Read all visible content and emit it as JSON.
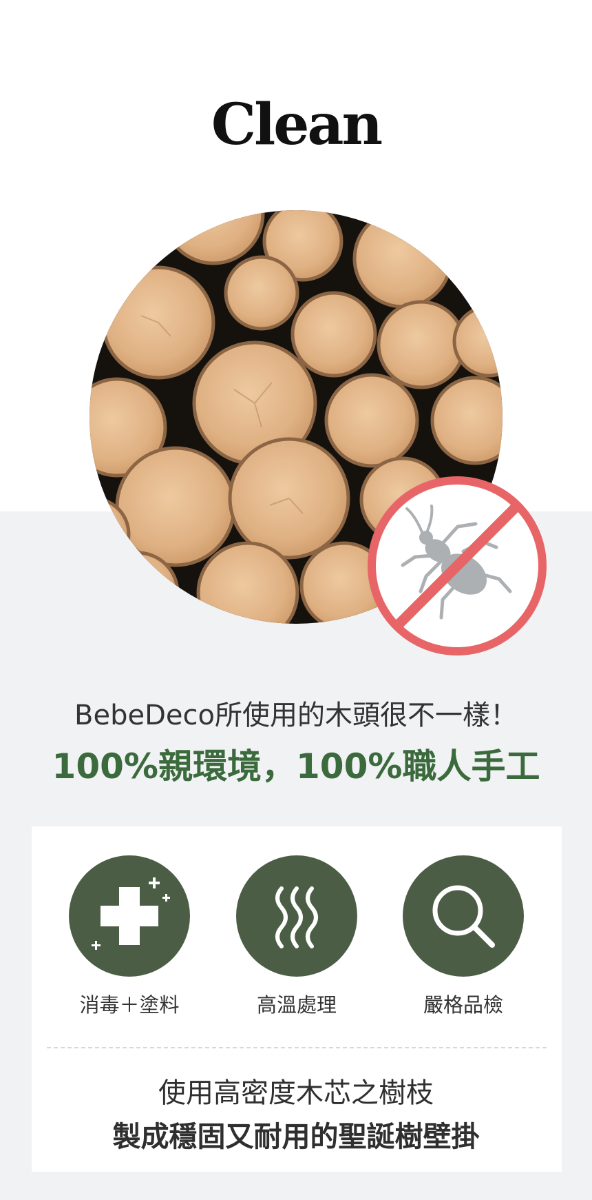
{
  "header": {
    "title": "Clean"
  },
  "intro": {
    "line": "BebeDeco所使用的木頭很不一樣！",
    "headline": "100%親環境，100%職人手工"
  },
  "features": [
    {
      "label": "消毒＋塗料",
      "icon": "medical-cross-icon"
    },
    {
      "label": "高溫處理",
      "icon": "heat-waves-icon"
    },
    {
      "label": "嚴格品檢",
      "icon": "magnifier-icon"
    }
  ],
  "description": {
    "line1": "使用高密度木芯之樹枝",
    "line2": "製成穩固又耐用的聖誕樹壁掛"
  },
  "colors": {
    "accent_green": "#3b6a3c",
    "icon_circle": "#4b5e45",
    "prohibit_red": "#e86567",
    "section_bg": "#f1f2f4"
  }
}
